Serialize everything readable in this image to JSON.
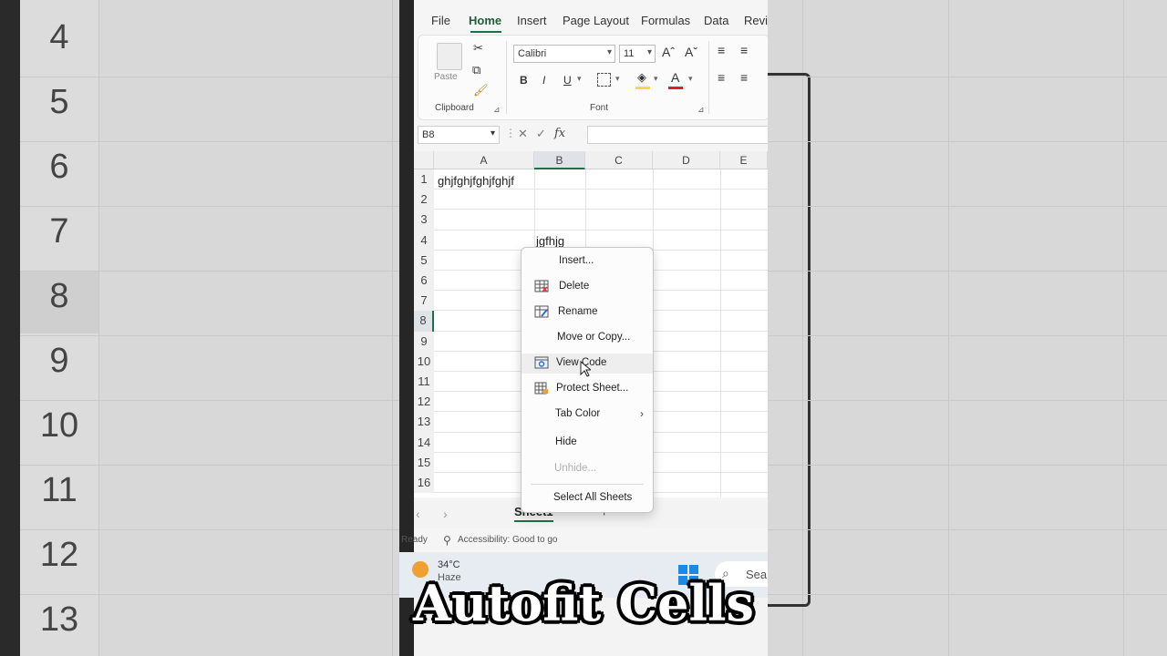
{
  "side_rows": [
    "4",
    "5",
    "6",
    "7",
    "8",
    "9",
    "10",
    "11",
    "12",
    "13"
  ],
  "ribbon": {
    "tabs": [
      "File",
      "Home",
      "Insert",
      "Page Layout",
      "Formulas",
      "Data",
      "Revi"
    ],
    "active_tab": "Home",
    "paste_label": "Paste",
    "clipboard_label": "Clipboard",
    "font_label": "Font",
    "font_name": "Calibri",
    "font_size": "11",
    "bold": "B",
    "italic": "I",
    "underline": "U",
    "grow_font": "Aˆ",
    "shrink_font": "Aˇ"
  },
  "formula_bar": {
    "name_box": "B8",
    "fx": "fx",
    "cancel": "✕",
    "enter": "✓"
  },
  "grid": {
    "columns": [
      "A",
      "B",
      "C",
      "D",
      "E"
    ],
    "selected_column": "B",
    "rows": [
      "1",
      "2",
      "3",
      "4",
      "5",
      "6",
      "7",
      "8",
      "9",
      "10",
      "11",
      "12",
      "13",
      "14",
      "15",
      "16"
    ],
    "selected_row": "8",
    "cells": {
      "A1": "ghjfghjfghjfghjf",
      "B4": "jgfhjg"
    }
  },
  "context_menu": {
    "items": [
      {
        "label": "Insert...",
        "icon": "",
        "disabled": false
      },
      {
        "label": "Delete",
        "icon": "delete-sheet-icon",
        "disabled": false
      },
      {
        "label": "Rename",
        "icon": "rename-sheet-icon",
        "disabled": false
      },
      {
        "label": "Move or Copy...",
        "icon": "",
        "disabled": false
      },
      {
        "label": "View Code",
        "icon": "view-code-icon",
        "disabled": false,
        "hover": true
      },
      {
        "label": "Protect Sheet...",
        "icon": "protect-sheet-icon",
        "disabled": false
      },
      {
        "label": "Tab Color",
        "icon": "",
        "disabled": false,
        "submenu": true
      },
      {
        "label": "Hide",
        "icon": "",
        "disabled": false
      },
      {
        "label": "Unhide...",
        "icon": "",
        "disabled": true
      },
      {
        "label": "Select All Sheets",
        "icon": "",
        "disabled": false
      }
    ]
  },
  "sheet_tabs": {
    "active": "Sheet1",
    "add": "+"
  },
  "status_bar": {
    "ready": "Ready",
    "accessibility": "Accessibility: Good to go"
  },
  "taskbar": {
    "temperature": "34°C",
    "weather": "Haze",
    "search": "Sea"
  },
  "caption": "Autofit Cells",
  "colors": {
    "excel_green": "#1e7145",
    "accent_blue": "#1e88e5"
  }
}
